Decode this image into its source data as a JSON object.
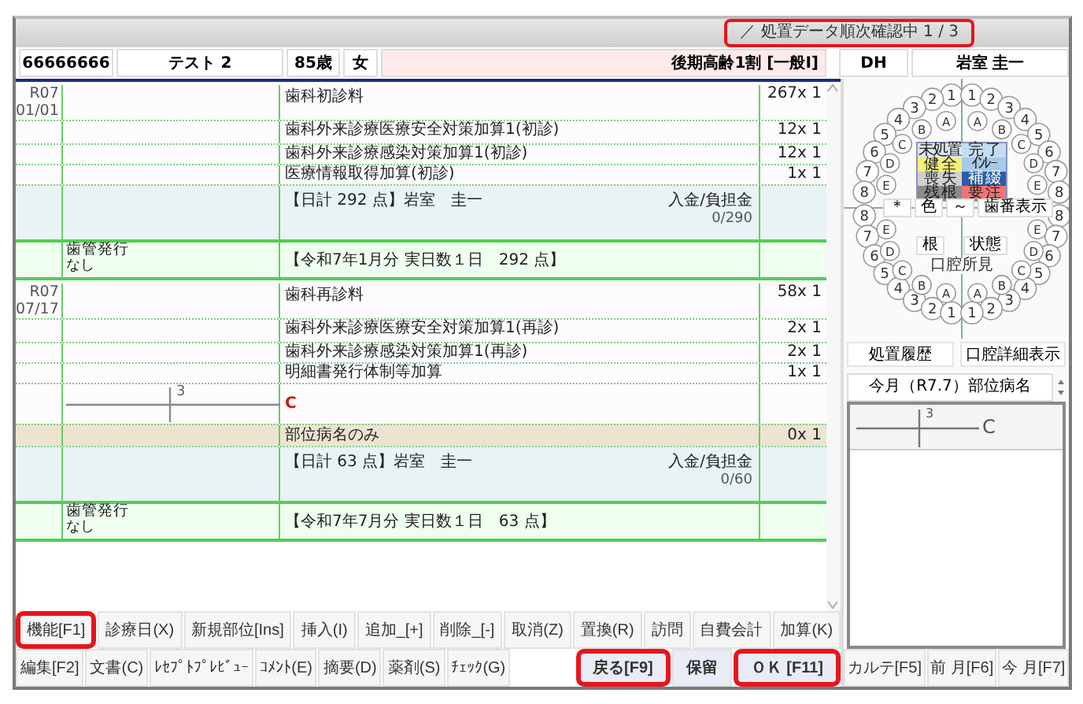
{
  "title_bar": {
    "status": "／ 処置データ順次確認中 1 / 3",
    "highlighted": true
  },
  "patient": {
    "id": "66666666",
    "name": "テスト 2",
    "age": "85歳",
    "sex": "女",
    "insurance": "後期高齢1割 [一般Ⅰ]",
    "role": "DH",
    "staff": "岩室 圭一"
  },
  "visits": [
    {
      "era": "R07",
      "date": "01/01",
      "items": [
        {
          "kind": "fee",
          "name": "歯科初診料",
          "amount": "267x 1"
        },
        {
          "kind": "addon",
          "name": "歯科外来診療医療安全対策加算1(初診)",
          "amount": "12x 1"
        },
        {
          "kind": "addon",
          "name": "歯科外来診療感染対策加算1(初診)",
          "amount": "12x 1"
        },
        {
          "kind": "addon",
          "name": "医療情報取得加算(初診)",
          "amount": "1x 1"
        }
      ],
      "summary": {
        "total": "【日計 292 点】岩室　圭一",
        "payment_label": "入金/負担金",
        "payment": "0/290"
      },
      "monthly": {
        "label": "歯管発行",
        "sub": "なし",
        "text": "【令和7年1月分 実日数１日　292 点】"
      }
    },
    {
      "era": "R07",
      "date": "07/17",
      "items": [
        {
          "kind": "fee",
          "name": "歯科再診料",
          "amount": "58x 1"
        },
        {
          "kind": "addon",
          "name": "歯科外来診療医療安全対策加算1(再診)",
          "amount": "2x 1"
        },
        {
          "kind": "addon",
          "name": "歯科外来診療感染対策加算1(再診)",
          "amount": "2x 1"
        },
        {
          "kind": "addon",
          "name": "明細書発行体制等加算",
          "amount": "1x 1"
        },
        {
          "kind": "site",
          "tooth": "3",
          "diagnosis": "C"
        },
        {
          "kind": "disease",
          "name": "部位病名のみ",
          "amount": "0x 1"
        }
      ],
      "summary": {
        "total": "【日計 63 点】岩室　圭一",
        "payment_label": "入金/負担金",
        "payment": "0/60"
      },
      "monthly": {
        "label": "歯管発行",
        "sub": "なし",
        "text": "【令和7年7月分 実日数１日　63 点】"
      }
    }
  ],
  "tooth_chart": {
    "upper": {
      "left": {
        "permanent": [
          "1",
          "2",
          "3",
          "4",
          "5",
          "6",
          "7",
          "8"
        ],
        "deciduous": [
          "A",
          "B",
          "C",
          "D",
          "E"
        ]
      },
      "right": {
        "permanent": [
          "1",
          "2",
          "3",
          "4",
          "5",
          "6",
          "7",
          "8"
        ],
        "deciduous": [
          "A",
          "B",
          "C",
          "D",
          "E"
        ]
      }
    },
    "lower": {
      "left": {
        "permanent": [
          "8",
          "7",
          "6",
          "5",
          "4",
          "3",
          "2",
          "1"
        ],
        "deciduous": [
          "E",
          "D",
          "C",
          "B",
          "A"
        ]
      },
      "right": {
        "permanent": [
          "8",
          "7",
          "6",
          "5",
          "4",
          "3",
          "2",
          "1"
        ],
        "deciduous": [
          "E",
          "D",
          "C",
          "B",
          "A"
        ]
      }
    },
    "legend": [
      {
        "label": "未処置",
        "color": "#dfe6f2"
      },
      {
        "label": "完 了",
        "color": "#c6dcf2"
      },
      {
        "label": "健 全",
        "color": "#f5f07a"
      },
      {
        "label": "ｲﾝﾚｰ",
        "color": "#a8c8ec"
      },
      {
        "label": "喪 失",
        "color": "#cfcfcf"
      },
      {
        "label": "補 綴",
        "color": "#2b5ea8"
      },
      {
        "label": "残 根",
        "color": "#8a8a8a"
      },
      {
        "label": "要 注",
        "color": "#f07474"
      }
    ],
    "tools": [
      "＊",
      "色",
      "～",
      "歯番表示"
    ],
    "lower_buttons": [
      "根",
      "状態"
    ],
    "caption": "口腔所見"
  },
  "panel_buttons": [
    "処置履歴",
    "口腔詳細表示"
  ],
  "site_list": {
    "header": "今月（R7.7）部位病名",
    "entries": [
      {
        "tooth": "3",
        "diagnosis": "C"
      }
    ]
  },
  "function_keys": [
    [
      {
        "label": "機能[F1]",
        "highlighted": true
      },
      {
        "label": "診療日(X)",
        "highlighted": false
      },
      {
        "label": "新規部位[Ins]",
        "highlighted": false
      },
      {
        "label": "挿入(I)",
        "highlighted": false
      },
      {
        "label": "追加_[+]",
        "highlighted": false
      },
      {
        "label": "削除_[-]",
        "highlighted": false
      },
      {
        "label": "取消(Z)",
        "highlighted": false
      },
      {
        "label": "置換(R)",
        "highlighted": false
      },
      {
        "label": "訪問",
        "highlighted": false
      },
      {
        "label": "自費会計",
        "highlighted": false
      },
      {
        "label": "加算(K)",
        "highlighted": false
      }
    ],
    [
      {
        "label": "編集[F2]",
        "highlighted": false
      },
      {
        "label": "文書(C)",
        "highlighted": false
      },
      {
        "label": "ﾚｾﾌﾟﾄﾌﾟﾚﾋﾞｭｰ",
        "highlighted": false
      },
      {
        "label": "ｺﾒﾝﾄ(E)",
        "highlighted": false
      },
      {
        "label": "摘要(D)",
        "highlighted": false
      },
      {
        "label": "薬剤(S)",
        "highlighted": false
      },
      {
        "label": "ﾁｪｯｸ(G)",
        "highlighted": false
      }
    ]
  ],
  "action_buttons": [
    {
      "label": "戻る[F9]",
      "highlighted": true
    },
    {
      "label": "保留",
      "highlighted": false
    },
    {
      "label": "ＯＫ [F11]",
      "highlighted": true
    }
  ],
  "nav_buttons": [
    "カルテ[F5]",
    "前 月[F6]",
    "今 月[F7]"
  ]
}
